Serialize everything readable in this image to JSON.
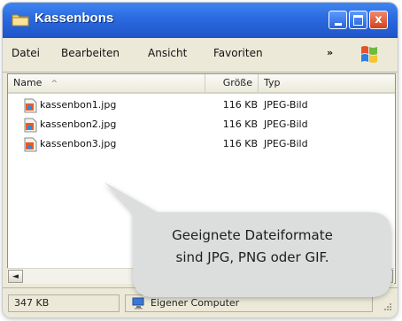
{
  "window": {
    "title": "Kassenbons",
    "buttons": {
      "minimize": "_",
      "close": "x"
    }
  },
  "menu": {
    "items": [
      {
        "label": "Datei"
      },
      {
        "label": "Bearbeiten"
      },
      {
        "label": "Ansicht"
      },
      {
        "label": "Favoriten"
      }
    ],
    "overflow": "»"
  },
  "columns": {
    "name": "Name",
    "sort_indicator": "^",
    "size": "Größe",
    "type": "Typ"
  },
  "files": [
    {
      "name": "kassenbon1.jpg",
      "size": "116 KB",
      "type": "JPEG-Bild"
    },
    {
      "name": "kassenbon2.jpg",
      "size": "116 KB",
      "type": "JPEG-Bild"
    },
    {
      "name": "kassenbon3.jpg",
      "size": "116 KB",
      "type": "JPEG-Bild"
    }
  ],
  "scrollbar": {
    "left_arrow": "◄",
    "right_arrow": "►"
  },
  "status": {
    "total_size": "347 KB",
    "location": "Eigener Computer"
  },
  "callout": {
    "line1": "Geeignete Dateiformate",
    "line2": "sind JPG, PNG oder GIF."
  },
  "colors": {
    "titlebar": "#2a69df",
    "chrome": "#ece9d8",
    "callout": "#dcdedd"
  },
  "icons": [
    "folder-icon",
    "windows-logo-icon",
    "jpeg-file-icon",
    "computer-icon",
    "resize-grip-icon"
  ]
}
